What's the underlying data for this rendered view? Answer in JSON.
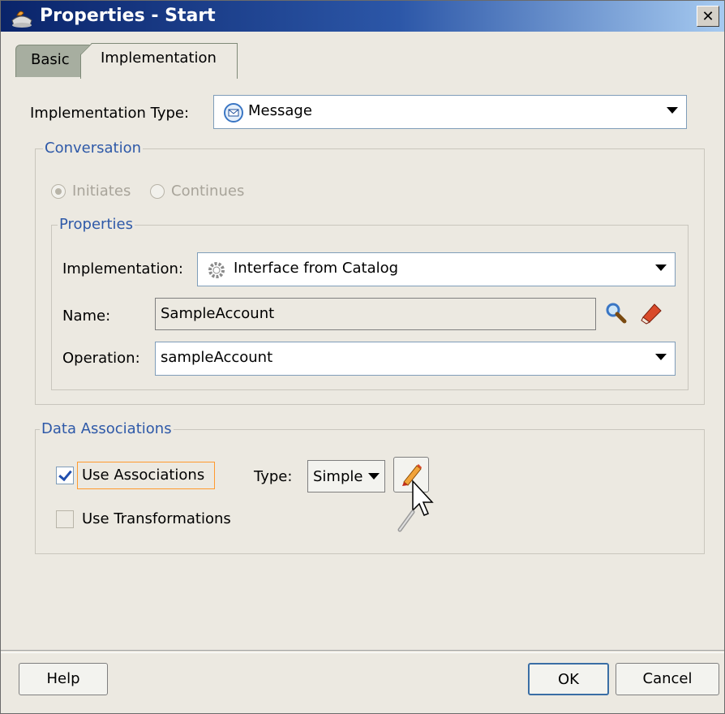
{
  "window": {
    "title": "Properties - Start",
    "close_glyph": "✕"
  },
  "tabs": [
    {
      "label": "Basic"
    },
    {
      "label": "Implementation"
    }
  ],
  "implementation_type": {
    "label": "Implementation Type:",
    "value": "Message",
    "icon": "message-icon"
  },
  "conversation": {
    "legend": "Conversation",
    "initiates_label": "Initiates",
    "continues_label": "Continues",
    "selected": "Initiates",
    "properties": {
      "legend": "Properties",
      "implementation_label": "Implementation:",
      "implementation_value": "Interface from Catalog",
      "implementation_icon": "gear-icon",
      "name_label": "Name:",
      "name_value": "SampleAccount",
      "operation_label": "Operation:",
      "operation_value": "sampleAccount"
    }
  },
  "data_associations": {
    "legend": "Data Associations",
    "use_associations_label": "Use Associations",
    "use_associations_checked": true,
    "type_label": "Type:",
    "type_value": "Simple",
    "use_transformations_label": "Use Transformations",
    "use_transformations_checked": false
  },
  "buttons": {
    "help": "Help",
    "ok": "OK",
    "cancel": "Cancel"
  },
  "colors": {
    "title_start": "#0a246a",
    "title_end": "#a6caf0",
    "legend": "#2e59a8",
    "focus": "#ff9a2e"
  }
}
